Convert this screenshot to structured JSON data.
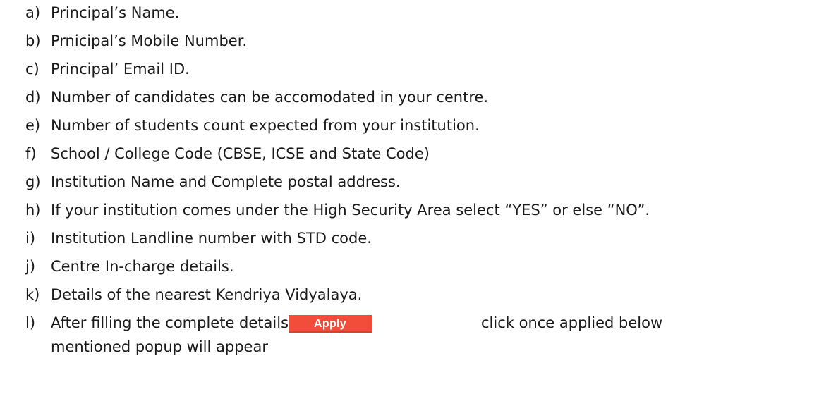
{
  "items": [
    {
      "marker": "a)",
      "text": "Principal’s Name."
    },
    {
      "marker": "b)",
      "text": "Prnicipal’s Mobile Number."
    },
    {
      "marker": "c)",
      "text": "Principal’ Email ID."
    },
    {
      "marker": "d)",
      "text": "Number of candidates can be accomodated in your centre."
    },
    {
      "marker": "e)",
      "text": "Number of students  count expected from your institution."
    },
    {
      "marker": "f)",
      "text": "School / College Code (CBSE, ICSE and State Code)"
    },
    {
      "marker": "g)",
      "text": "Institution Name and Complete postal address."
    },
    {
      "marker": "h)",
      "text": "If your institution comes under the High Security Area select “YES” or else “NO”."
    },
    {
      "marker": "i)",
      "text": "Institution Landline number with STD code."
    },
    {
      "marker": "j)",
      "text": "Centre In-charge details."
    },
    {
      "marker": "k)",
      "text": "Details of the nearest Kendriya Vidyalaya."
    }
  ],
  "last_item": {
    "marker": "l)",
    "text_before": "After filling the complete details",
    "button_label": "Apply",
    "text_after": "click once applied below",
    "text_line2": "mentioned popup will appear"
  },
  "colors": {
    "button_bg": "#f24d3a",
    "button_text": "#ffffff"
  }
}
